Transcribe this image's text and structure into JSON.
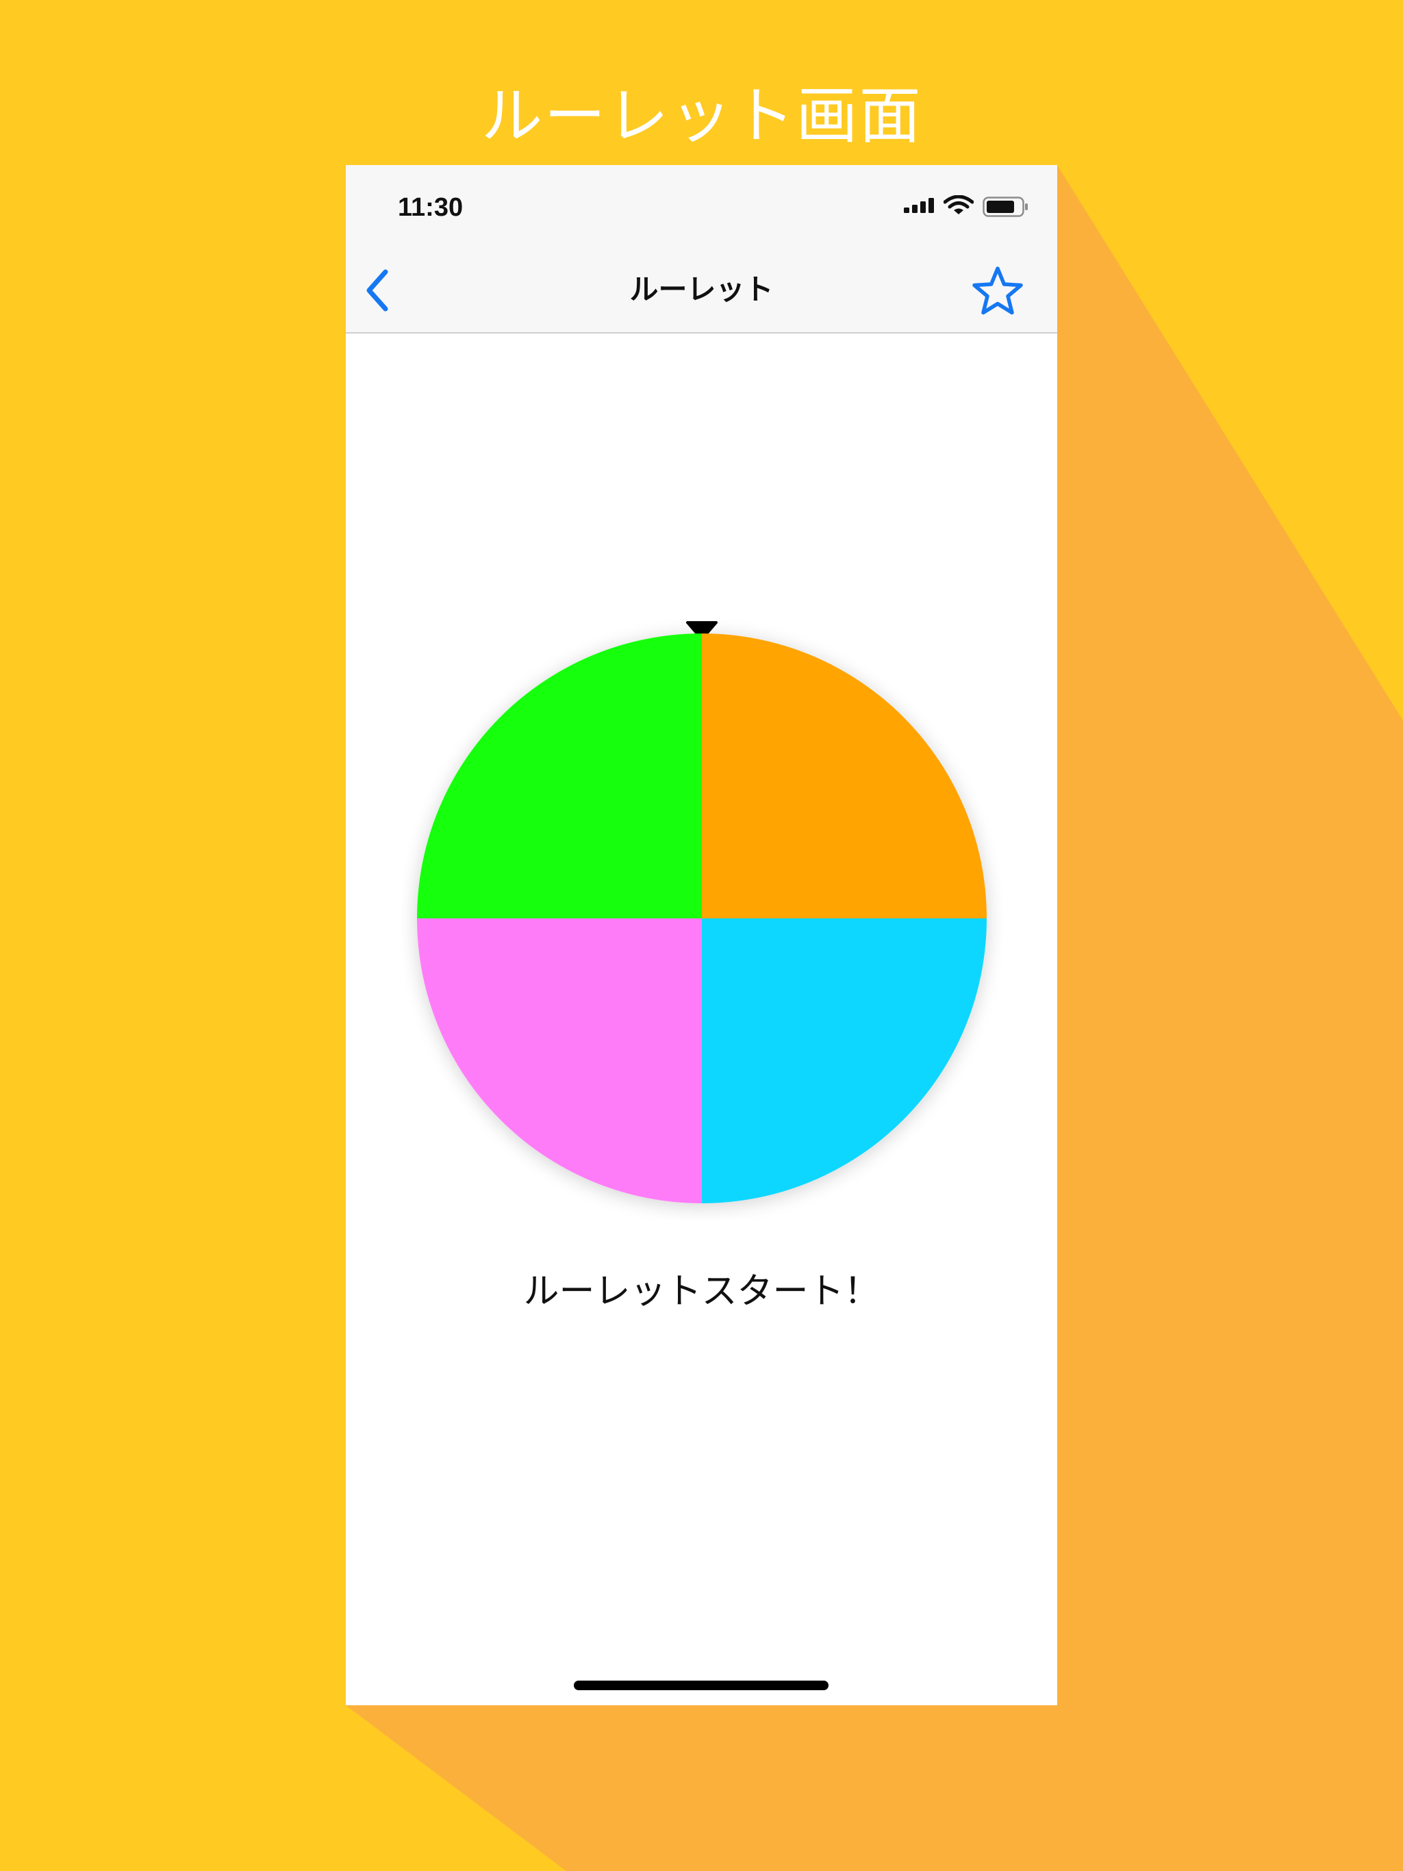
{
  "screen_caption": "ルーレット画面",
  "status_bar": {
    "time": "11:30"
  },
  "nav": {
    "title": "ルーレット"
  },
  "roulette": {
    "segments": [
      {
        "name": "top-right",
        "color": "#FFA405"
      },
      {
        "name": "bottom-right",
        "color": "#0BD7FF"
      },
      {
        "name": "bottom-left",
        "color": "#FF7BF8"
      },
      {
        "name": "top-left",
        "color": "#13FF0E"
      }
    ]
  },
  "start_button": {
    "label": "ルーレットスタート！"
  },
  "colors": {
    "background": "#FFCA22",
    "shadow": "#FBB03B",
    "accent": "#1677F2"
  },
  "icons": [
    "back-chevron-icon",
    "star-icon",
    "signal-icon",
    "wifi-icon",
    "battery-icon",
    "pointer-triangle-icon"
  ]
}
